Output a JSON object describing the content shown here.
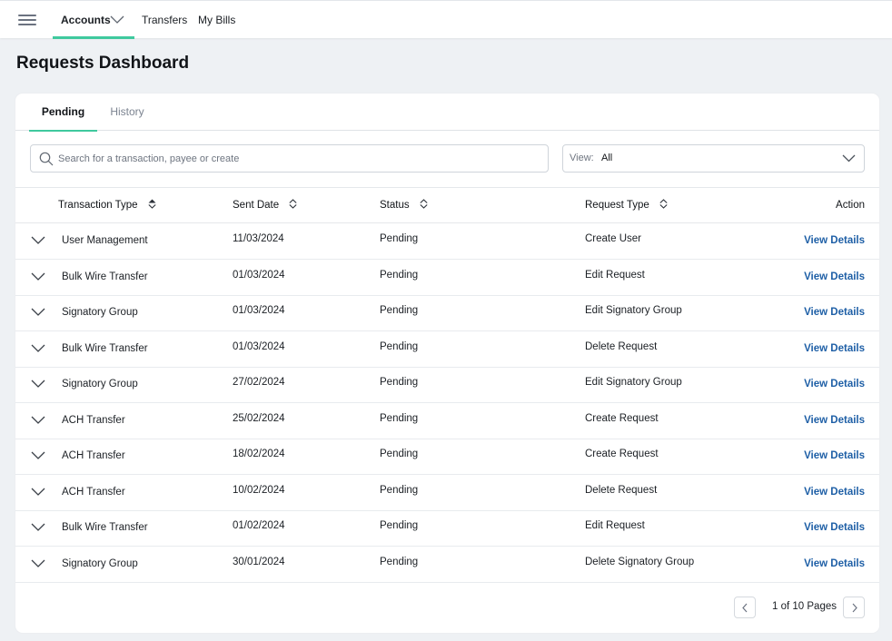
{
  "nav": {
    "items": [
      "Accounts",
      "Transfers",
      "My Bills"
    ],
    "accent": "#3fc99e"
  },
  "page": {
    "title": "Requests Dashboard"
  },
  "tabs": [
    "Pending",
    "History"
  ],
  "search": {
    "placeholder": "Search for a transaction, payee or create"
  },
  "view": {
    "label": "View:",
    "value": "All"
  },
  "table": {
    "columns": [
      "Transaction Type",
      "Sent Date",
      "Status",
      "Request Type",
      "Action"
    ],
    "rows": [
      {
        "type": "User Management",
        "date": "11/03/2024",
        "status": "Pending",
        "request": "Create User",
        "action": "View Details"
      },
      {
        "type": "Bulk Wire Transfer",
        "date": "01/03/2024",
        "status": "Pending",
        "request": "Edit Request",
        "action": "View Details"
      },
      {
        "type": "Signatory Group",
        "date": "01/03/2024",
        "status": "Pending",
        "request": "Edit Signatory Group",
        "action": "View Details"
      },
      {
        "type": "Bulk Wire Transfer",
        "date": "01/03/2024",
        "status": "Pending",
        "request": "Delete Request",
        "action": "View Details"
      },
      {
        "type": "Signatory Group",
        "date": "27/02/2024",
        "status": "Pending",
        "request": "Edit Signatory Group",
        "action": "View Details"
      },
      {
        "type": "ACH Transfer",
        "date": "25/02/2024",
        "status": "Pending",
        "request": "Create Request",
        "action": "View Details"
      },
      {
        "type": "ACH Transfer",
        "date": "18/02/2024",
        "status": "Pending",
        "request": "Create Request",
        "action": "View Details"
      },
      {
        "type": "ACH Transfer",
        "date": "10/02/2024",
        "status": "Pending",
        "request": "Delete Request",
        "action": "View Details"
      },
      {
        "type": "Bulk Wire Transfer",
        "date": "01/02/2024",
        "status": "Pending",
        "request": "Edit Request",
        "action": "View Details"
      },
      {
        "type": "Signatory Group",
        "date": "30/01/2024",
        "status": "Pending",
        "request": "Delete Signatory Group",
        "action": "View Details"
      }
    ]
  },
  "pagination": {
    "text": "1 of 10 Pages"
  },
  "colors": {
    "link": "#1e5fa6",
    "accent": "#3fc99e",
    "background": "#eef1f4"
  }
}
